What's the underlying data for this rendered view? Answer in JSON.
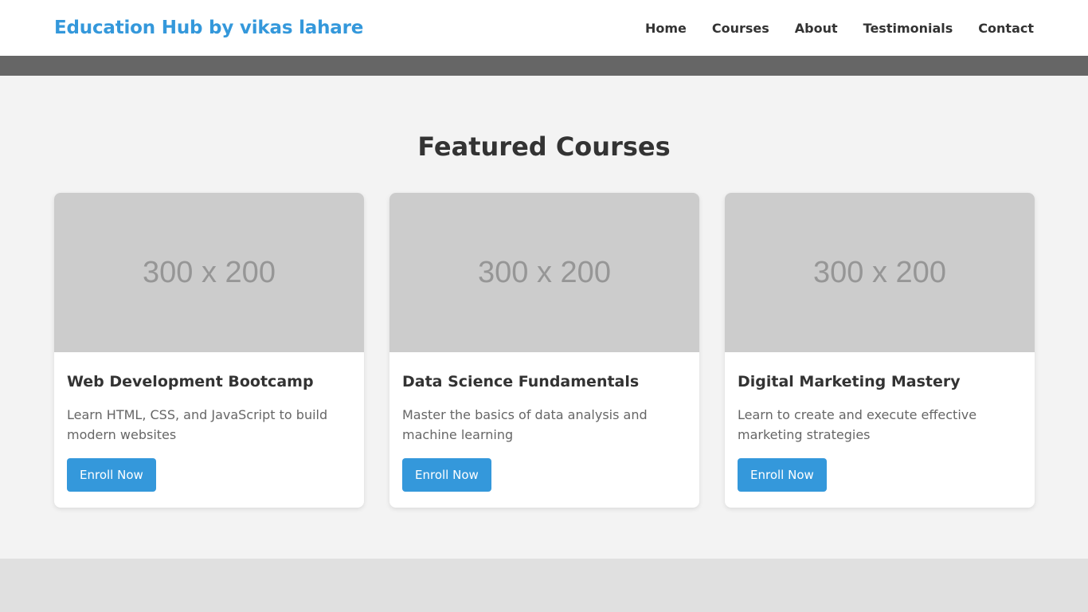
{
  "nav": {
    "brand": "Education Hub by vikas lahare",
    "links": [
      "Home",
      "Courses",
      "About",
      "Testimonials",
      "Contact"
    ]
  },
  "featured": {
    "title": "Featured Courses",
    "courses": [
      {
        "image_text": "300 x 200",
        "title": "Web Development Bootcamp",
        "description": "Learn HTML, CSS, and JavaScript to build modern websites",
        "button": "Enroll Now"
      },
      {
        "image_text": "300 x 200",
        "title": "Data Science Fundamentals",
        "description": "Master the basics of data analysis and machine learning",
        "button": "Enroll Now"
      },
      {
        "image_text": "300 x 200",
        "title": "Digital Marketing Mastery",
        "description": "Learn to create and execute effective marketing strategies",
        "button": "Enroll Now"
      }
    ]
  },
  "colors": {
    "accent": "#3498db",
    "hero_strip": "#666666",
    "section_bg": "#f3f3f3",
    "placeholder_bg": "#cccccc"
  }
}
